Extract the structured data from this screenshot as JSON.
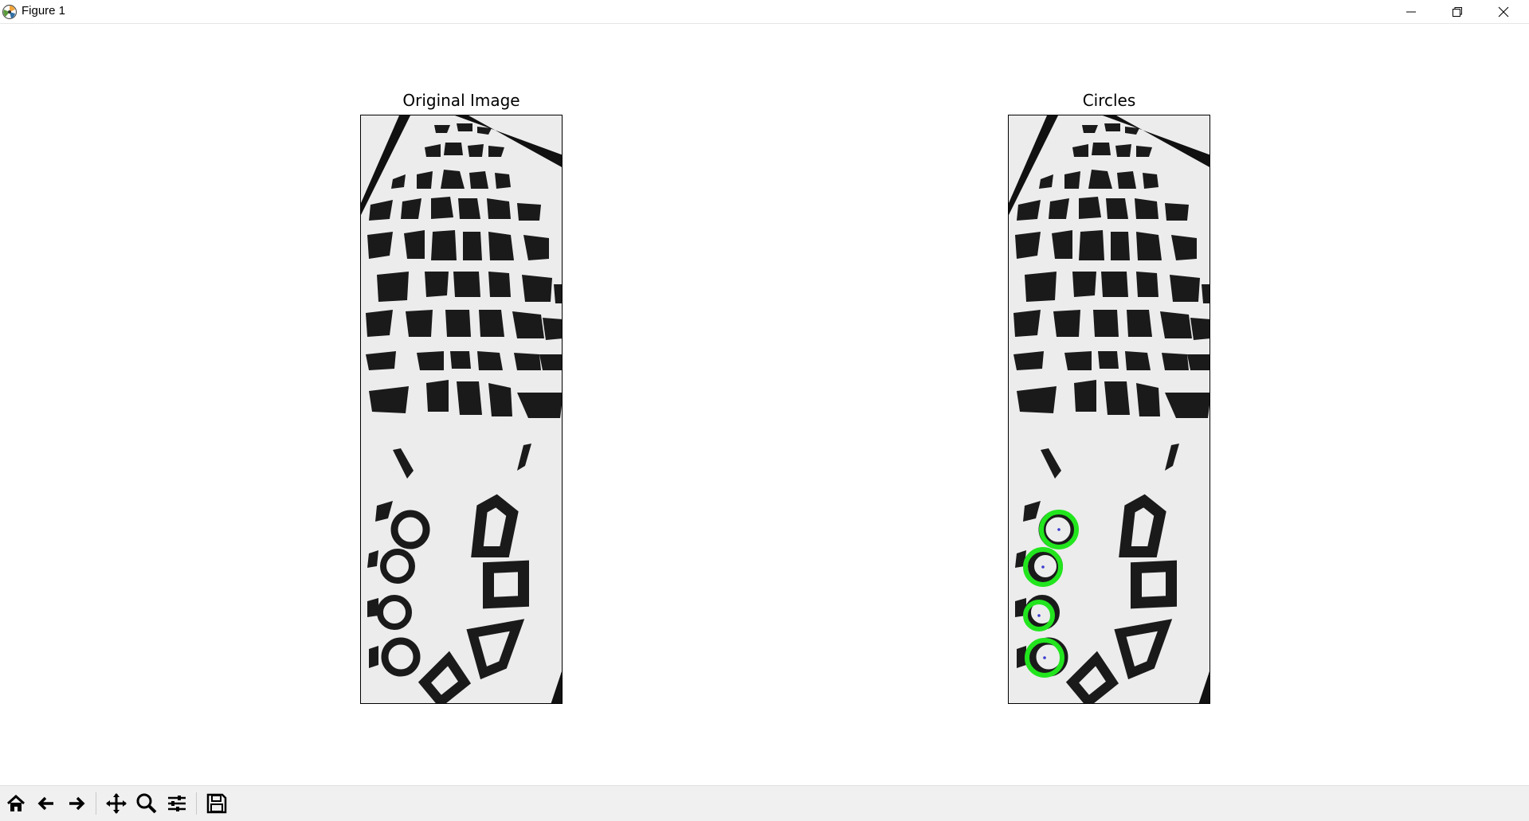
{
  "window": {
    "title": "Figure 1",
    "controls": [
      "minimize-icon",
      "restore-icon",
      "close-icon"
    ]
  },
  "figure": {
    "subplots": [
      {
        "title": "Original Image"
      },
      {
        "title": "Circles"
      }
    ],
    "circle_color": "#22e51e",
    "detected_circles": 4
  },
  "toolbar": {
    "tools": [
      "home-icon",
      "back-arrow-icon",
      "forward-arrow-icon",
      "pan-icon",
      "zoom-icon",
      "configure-subplots-icon",
      "save-icon"
    ]
  }
}
